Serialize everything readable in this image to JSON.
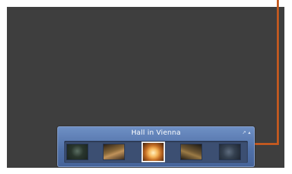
{
  "browser": {
    "title": "Hall in Vienna",
    "window_buttons": [
      "pin-icon",
      "close-icon"
    ],
    "thumbnails": [
      {
        "name": "thumbnail-1",
        "selected": false
      },
      {
        "name": "thumbnail-2",
        "selected": false
      },
      {
        "name": "thumbnail-3",
        "selected": true
      },
      {
        "name": "thumbnail-4",
        "selected": false
      },
      {
        "name": "thumbnail-5",
        "selected": false
      }
    ]
  },
  "colors": {
    "callout": "#c4591f",
    "background": "#3e3e3e",
    "panel": "#5a78ad"
  }
}
